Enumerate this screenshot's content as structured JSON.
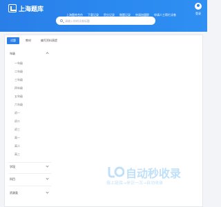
{
  "header": {
    "logo_text": "上海题库",
    "nav": [
      "上海题库合作",
      "下载记录",
      "积分记录",
      "做题记录",
      "申请加盟群",
      "申请人工帮忙试卷"
    ],
    "user_label": "登录",
    "search_placeholder": "请输入你的试卷标题"
  },
  "tabs": [
    {
      "label": "试题",
      "active": true
    },
    {
      "label": "教材",
      "active": false
    },
    {
      "label": "编写资料表提",
      "active": false
    }
  ],
  "sidebar": {
    "sections": [
      {
        "title": "年级",
        "expanded": true,
        "items": [
          "一年级",
          "二年级",
          "三年级",
          "四年级",
          "五年级",
          "六年级",
          "初一",
          "初二",
          "初三",
          "高一",
          "高二",
          "高三"
        ]
      },
      {
        "title": "学段",
        "expanded": false,
        "items": []
      },
      {
        "title": "科目",
        "expanded": false,
        "items": []
      },
      {
        "title": "资源类",
        "expanded": false,
        "items": []
      }
    ]
  },
  "watermark": {
    "brand": "自动秒收录",
    "tagline": "做上链接→来访一次→自动收录"
  },
  "colors": {
    "header_blue": "#2a84ec",
    "tab_active": "#2a7fe7"
  }
}
